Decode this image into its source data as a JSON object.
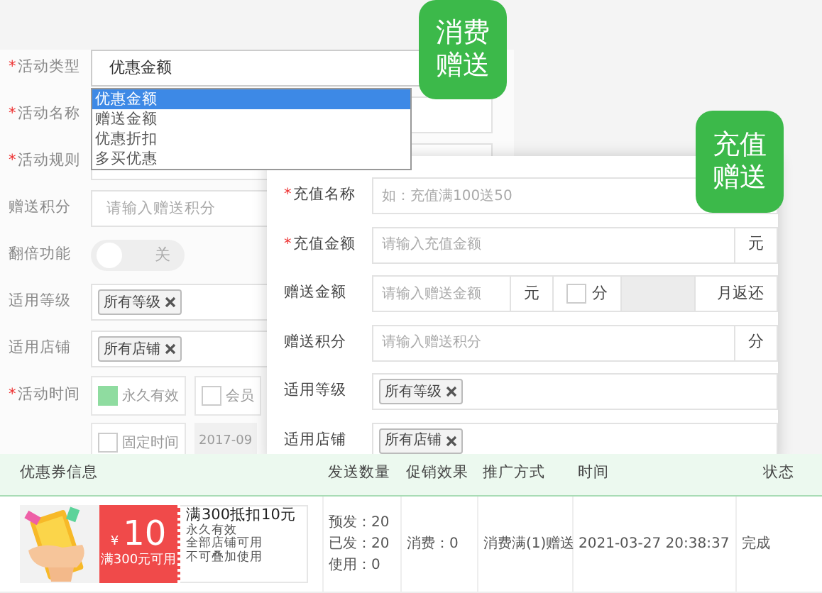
{
  "badges": [
    {
      "text": "消费赠送"
    },
    {
      "text": "充值赠送"
    }
  ],
  "activity_form": {
    "fields": [
      {
        "kind": "select",
        "label": "活动类型",
        "required_mark": "*",
        "value": "优惠金额",
        "expanded": true,
        "options": [
          {
            "label": "优惠金额",
            "selected": true
          },
          {
            "label": "赠送金额",
            "selected": false
          },
          {
            "label": "优惠折扣",
            "selected": false
          },
          {
            "label": "多买优惠",
            "selected": false
          }
        ]
      },
      {
        "kind": "text",
        "label": "活动名称",
        "required_mark": "*"
      },
      {
        "kind": "text",
        "label": "活动规则",
        "required_mark": "*"
      },
      {
        "kind": "text",
        "label": "赠送积分",
        "placeholder": "请输入赠送积分"
      },
      {
        "kind": "switch",
        "label": "翻倍功能",
        "on": false,
        "text": "关"
      },
      {
        "kind": "tags",
        "label": "适用等级",
        "tags": [
          "所有等级"
        ]
      },
      {
        "kind": "tags",
        "label": "适用店铺",
        "tags": [
          "所有店铺"
        ]
      },
      {
        "kind": "checks",
        "label": "活动时间",
        "required_mark": "*",
        "options": [
          {
            "label": "永久有效",
            "checked": true
          },
          {
            "label": "会员",
            "checked": false
          }
        ]
      },
      {
        "kind": "checks",
        "options": [
          {
            "label": "固定时间",
            "checked": false
          }
        ],
        "date": "2017-09"
      }
    ]
  },
  "recharge_form": {
    "fields": [
      {
        "kind": "text",
        "label": "充值名称",
        "required_mark": "*",
        "placeholder": "如：充值满100送50"
      },
      {
        "kind": "text",
        "label": "充值金额",
        "required_mark": "*",
        "placeholder": "请输入充值金额",
        "suffix": "元"
      },
      {
        "kind": "gift",
        "label": "赠送金额",
        "placeholder": "请输入赠送金额",
        "unit": "元",
        "check": {
          "label": "分",
          "checked": false
        },
        "suffix": "月返还"
      },
      {
        "kind": "text",
        "label": "赠送积分",
        "placeholder": "请输入赠送积分",
        "suffix": "分"
      },
      {
        "kind": "tags",
        "label": "适用等级",
        "tags": [
          "所有等级"
        ]
      },
      {
        "kind": "tags",
        "label": "适用店铺",
        "tags": [
          "所有店铺"
        ]
      }
    ]
  },
  "table": {
    "columns": [
      "优惠券信息",
      "发送数量",
      "促销效果",
      "推广方式",
      "时间",
      "状态"
    ],
    "rows": [
      {
        "coupon": {
          "currency": "¥",
          "amount": "10",
          "condition": "满300元可用",
          "title": "满300抵扣10元",
          "lines": [
            "永久有效",
            "全部店铺可用",
            "不可叠加使用"
          ]
        },
        "sent": [
          "预发：20",
          "已发：20",
          "使用：0"
        ],
        "effect": "消费：0",
        "method": "消费满(1)赠送",
        "time": "2021-03-27 20:38:37",
        "status": "完成"
      }
    ]
  }
}
